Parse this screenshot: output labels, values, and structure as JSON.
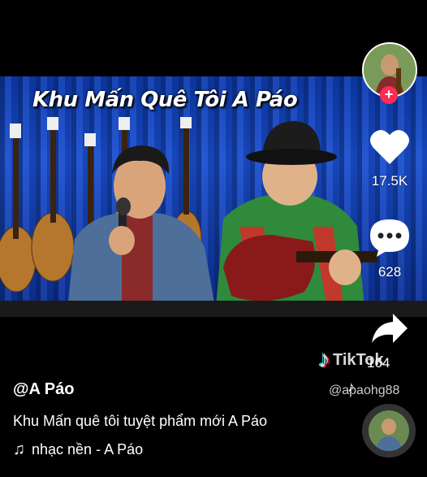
{
  "video": {
    "overlay_title": "Khu Mấn Quê Tôi A Páo"
  },
  "sidebar": {
    "likes": "17.5K",
    "comments": "628",
    "shares": "164",
    "follow_symbol": "+"
  },
  "watermark": {
    "brand": "TikTok",
    "handle": "@apaohg88"
  },
  "post": {
    "username": "@A Páo",
    "caption": "Khu Mấn quê tôi tuyệt phẩm mới A Páo",
    "music": "nhạc nền - A Páo"
  },
  "colors": {
    "accent": "#fe2c55",
    "stage_blue": "#1a4fd0"
  }
}
